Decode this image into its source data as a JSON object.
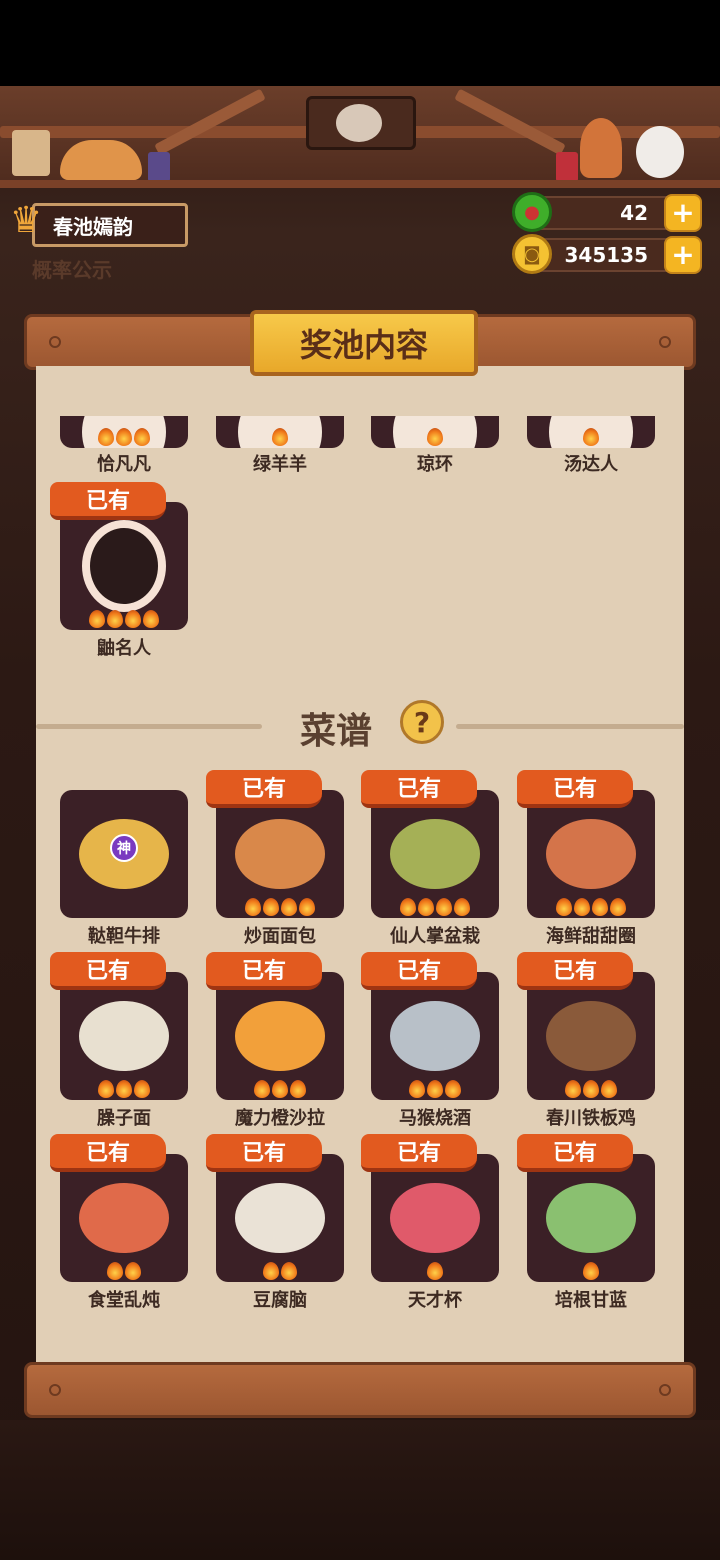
{
  "header": {
    "pool_name": "春池嫣韵",
    "probability_link": "概率公示",
    "jade": "42",
    "coins": "345135"
  },
  "panel": {
    "title": "奖池内容"
  },
  "characters": [
    {
      "name": "恰凡凡",
      "owned": false,
      "stars": 3
    },
    {
      "name": "绿羊羊",
      "owned": false,
      "stars": 1
    },
    {
      "name": "琼环",
      "owned": false,
      "stars": 1
    },
    {
      "name": "汤达人",
      "owned": false,
      "stars": 1
    },
    {
      "name": "鼬名人",
      "owned": true,
      "owned_label": "已有",
      "stars": 4
    }
  ],
  "recipes_section": {
    "title": "菜谱",
    "help_icon": "?"
  },
  "recipes": [
    {
      "name": "鞑靼牛排",
      "owned": false,
      "badge": "神",
      "stars": 0
    },
    {
      "name": "炒面面包",
      "owned": true,
      "owned_label": "已有",
      "stars": 4
    },
    {
      "name": "仙人掌盆栽",
      "owned": true,
      "owned_label": "已有",
      "stars": 4
    },
    {
      "name": "海鲜甜甜圈",
      "owned": true,
      "owned_label": "已有",
      "stars": 4
    },
    {
      "name": "臊子面",
      "owned": true,
      "owned_label": "已有",
      "stars": 3
    },
    {
      "name": "魔力橙沙拉",
      "owned": true,
      "owned_label": "已有",
      "stars": 3
    },
    {
      "name": "马猴烧酒",
      "owned": true,
      "owned_label": "已有",
      "stars": 3
    },
    {
      "name": "春川铁板鸡",
      "owned": true,
      "owned_label": "已有",
      "stars": 3
    },
    {
      "name": "食堂乱炖",
      "owned": true,
      "owned_label": "已有",
      "stars": 2
    },
    {
      "name": "豆腐脑",
      "owned": true,
      "owned_label": "已有",
      "stars": 2
    },
    {
      "name": "天才杯",
      "owned": true,
      "owned_label": "已有",
      "stars": 1
    },
    {
      "name": "培根甘蓝",
      "owned": true,
      "owned_label": "已有",
      "stars": 1
    }
  ],
  "colors": {
    "panel_bg": "#e1cfb6",
    "card_bg": "#3b2026",
    "owned_tag": "#e25a1f",
    "title_gold": "#f2c24a"
  }
}
